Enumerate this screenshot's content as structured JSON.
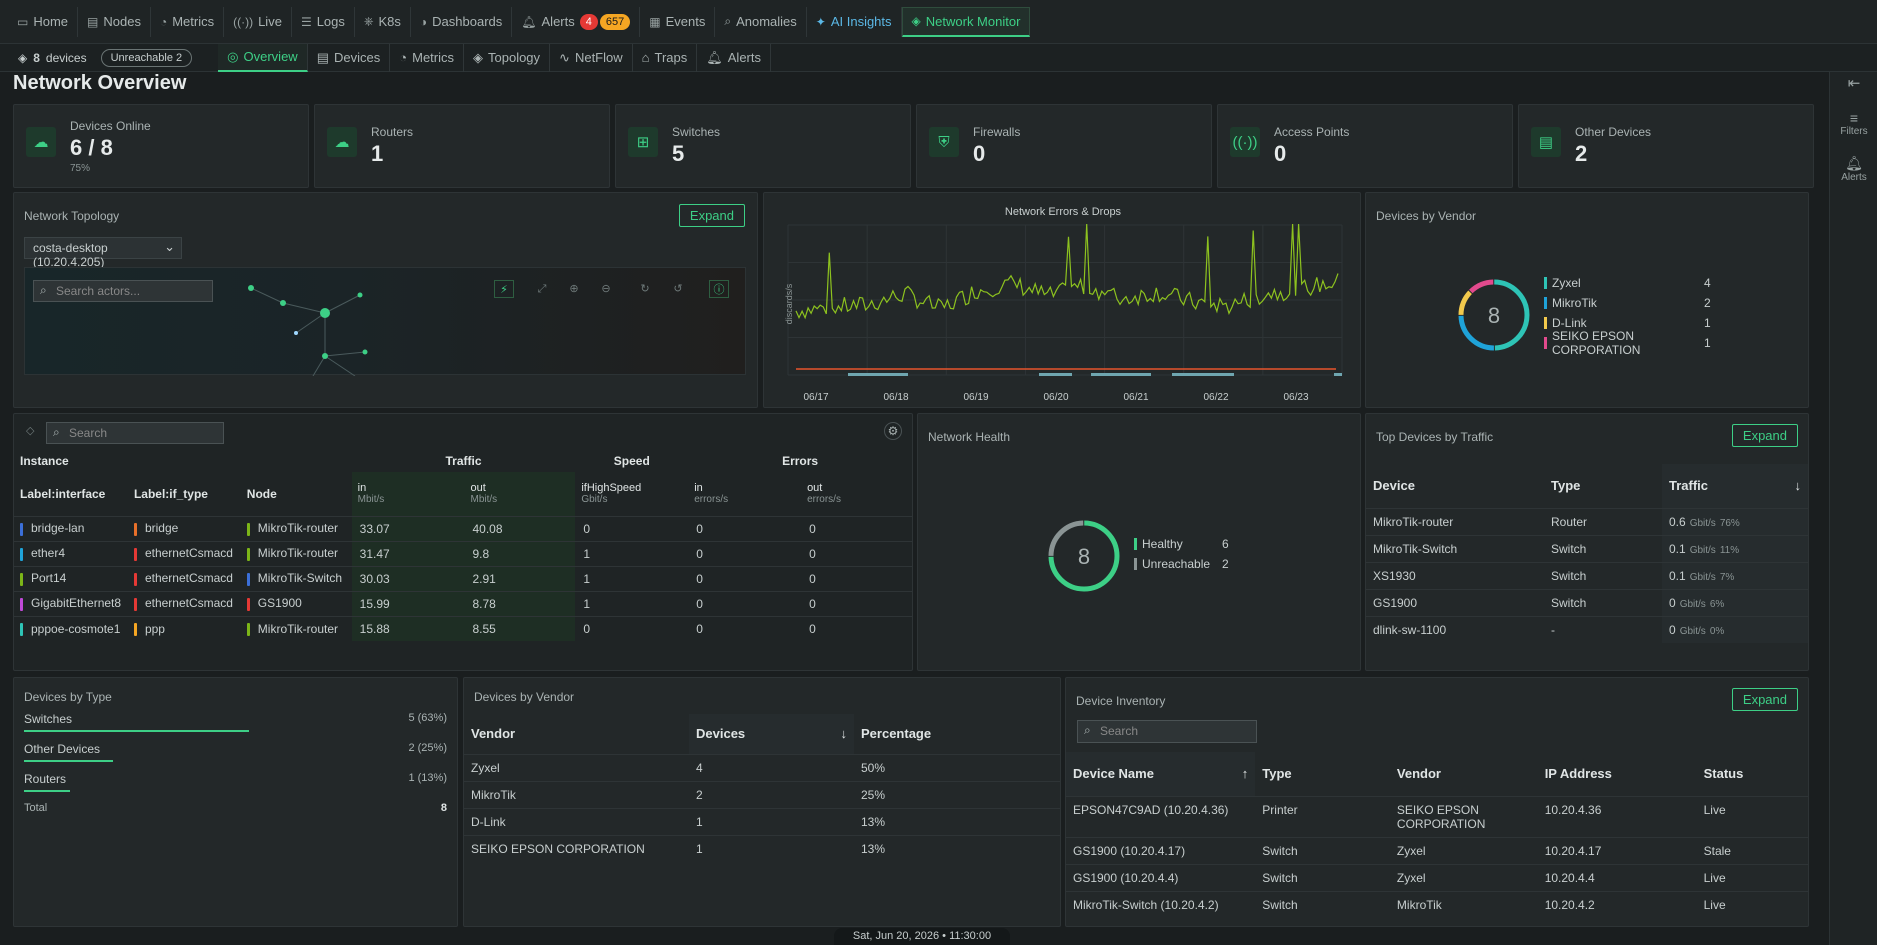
{
  "nav": {
    "tabs": [
      {
        "label": "Home",
        "icon": "monitor-icon"
      },
      {
        "label": "Nodes",
        "icon": "server-icon"
      },
      {
        "label": "Metrics",
        "icon": "metrics-icon"
      },
      {
        "label": "Live",
        "icon": "live-icon"
      },
      {
        "label": "Logs",
        "icon": "logs-icon"
      },
      {
        "label": "K8s",
        "icon": "k8s-icon"
      },
      {
        "label": "Dashboards",
        "icon": "dashboard-icon"
      },
      {
        "label": "Alerts",
        "icon": "bell-icon"
      },
      {
        "label": "Events",
        "icon": "events-icon"
      },
      {
        "label": "Anomalies",
        "icon": "anomaly-icon"
      },
      {
        "label": "AI Insights",
        "icon": "sparkle-icon"
      },
      {
        "label": "Network Monitor",
        "icon": "layers-icon"
      }
    ],
    "alerts_critical": "4",
    "alerts_warning": "657"
  },
  "subnav": {
    "device_count": "8",
    "device_word": "devices",
    "unreachable": "Unreachable 2",
    "tabs": [
      "Overview",
      "Devices",
      "Metrics",
      "Topology",
      "NetFlow",
      "Traps",
      "Alerts"
    ]
  },
  "rail": {
    "filters": "Filters",
    "alerts": "Alerts"
  },
  "page_title": "Network Overview",
  "kpis": [
    {
      "label": "Devices Online",
      "value": "6 / 8",
      "sub": "75%"
    },
    {
      "label": "Routers",
      "value": "1"
    },
    {
      "label": "Switches",
      "value": "5"
    },
    {
      "label": "Firewalls",
      "value": "0"
    },
    {
      "label": "Access Points",
      "value": "0"
    },
    {
      "label": "Other Devices",
      "value": "2"
    }
  ],
  "topology": {
    "title": "Network Topology",
    "expand": "Expand",
    "selected": "costa-desktop (10.20.4.205)",
    "search_placeholder": "Search actors..."
  },
  "errors_chart": {
    "title": "Network Errors & Drops",
    "ylabel": "discards/s"
  },
  "chart_data": {
    "type": "line",
    "title": "Network Errors & Drops",
    "ylabel": "discards/s",
    "x": [
      "06/17",
      "06/18",
      "06/19",
      "06/20",
      "06/21",
      "06/22",
      "06/23"
    ],
    "series": [
      {
        "values": [
          38,
          42,
          45,
          58,
          40,
          62,
          70,
          55,
          68,
          52,
          60,
          48,
          44,
          58,
          64,
          72
        ]
      },
      {
        "values": [
          2,
          2,
          2,
          2,
          2,
          2,
          2,
          2,
          2,
          2,
          2,
          2,
          2,
          2,
          2,
          2
        ]
      }
    ]
  },
  "vendor_donut": {
    "title": "Devices by Vendor",
    "total": "8",
    "items": [
      {
        "name": "Zyxel",
        "count": "4",
        "color": "#2ec4b6",
        "value": 4
      },
      {
        "name": "MikroTik",
        "count": "2",
        "color": "#1fa3d9",
        "value": 2
      },
      {
        "name": "D-Link",
        "count": "1",
        "color": "#f2c94c",
        "value": 1
      },
      {
        "name": "SEIKO EPSON CORPORATION",
        "count": "1",
        "color": "#e24a8d",
        "value": 1
      }
    ]
  },
  "instances": {
    "search_placeholder": "Search",
    "groups": {
      "instance": "Instance",
      "traffic": "Traffic",
      "speed": "Speed",
      "errors": "Errors"
    },
    "cols": {
      "iface": "Label:interface",
      "type": "Label:if_type",
      "node": "Node",
      "in": "in",
      "in_unit": "Mbit/s",
      "out": "out",
      "out_unit": "Mbit/s",
      "speed": "ifHighSpeed",
      "speed_unit": "Gbit/s",
      "ein": "in",
      "ein_unit": "errors/s",
      "eout": "out",
      "eout_unit": "errors/s"
    },
    "rows": [
      {
        "iface": "bridge-lan",
        "ic": "#3b6fd8",
        "type": "bridge",
        "tc": "#e8702a",
        "node": "MikroTik-router",
        "nc": "#7cb518",
        "in": "33.07",
        "out": "40.08",
        "speed": "0",
        "ein": "0",
        "eout": "0"
      },
      {
        "iface": "ether4",
        "ic": "#1fa3d9",
        "type": "ethernetCsmacd",
        "tc": "#e53935",
        "node": "MikroTik-router",
        "nc": "#7cb518",
        "in": "31.47",
        "out": "9.8",
        "speed": "1",
        "ein": "0",
        "eout": "0"
      },
      {
        "iface": "Port14",
        "ic": "#7cb518",
        "type": "ethernetCsmacd",
        "tc": "#e53935",
        "node": "MikroTik-Switch",
        "nc": "#3b6fd8",
        "in": "30.03",
        "out": "2.91",
        "speed": "1",
        "ein": "0",
        "eout": "0"
      },
      {
        "iface": "GigabitEthernet8",
        "ic": "#c04ad8",
        "type": "ethernetCsmacd",
        "tc": "#e53935",
        "node": "GS1900",
        "nc": "#e53935",
        "in": "15.99",
        "out": "8.78",
        "speed": "1",
        "ein": "0",
        "eout": "0"
      },
      {
        "iface": "pppoe-cosmote1",
        "ic": "#2ec4b6",
        "type": "ppp",
        "tc": "#f5a623",
        "node": "MikroTik-router",
        "nc": "#7cb518",
        "in": "15.88",
        "out": "8.55",
        "speed": "0",
        "ein": "0",
        "eout": "0"
      }
    ]
  },
  "health": {
    "title": "Network Health",
    "total": "8",
    "items": [
      {
        "name": "Healthy",
        "count": "6",
        "color": "#3dcf86",
        "value": 6
      },
      {
        "name": "Unreachable",
        "count": "2",
        "color": "#8a9494",
        "value": 2
      }
    ]
  },
  "top_devices": {
    "title": "Top Devices by Traffic",
    "expand": "Expand",
    "cols": [
      "Device",
      "Type",
      "Traffic"
    ],
    "rows": [
      {
        "device": "MikroTik-router",
        "type": "Router",
        "val": "0.6",
        "unit": "Gbit/s",
        "pct": "76%"
      },
      {
        "device": "MikroTik-Switch",
        "type": "Switch",
        "val": "0.1",
        "unit": "Gbit/s",
        "pct": "11%"
      },
      {
        "device": "XS1930",
        "type": "Switch",
        "val": "0.1",
        "unit": "Gbit/s",
        "pct": "7%"
      },
      {
        "device": "GS1900",
        "type": "Switch",
        "val": "0",
        "unit": "Gbit/s",
        "pct": "6%"
      },
      {
        "device": "dlink-sw-1100",
        "type": "-",
        "val": "0",
        "unit": "Gbit/s",
        "pct": "0%"
      }
    ]
  },
  "by_type": {
    "title": "Devices by Type",
    "rows": [
      {
        "label": "Switches",
        "value": "5 (63%)",
        "frac": 0.63
      },
      {
        "label": "Other Devices",
        "value": "2 (25%)",
        "frac": 0.25
      },
      {
        "label": "Routers",
        "value": "1 (13%)",
        "frac": 0.13
      }
    ],
    "total_label": "Total",
    "total": "8"
  },
  "by_vendor": {
    "title": "Devices by Vendor",
    "cols": [
      "Vendor",
      "Devices",
      "Percentage"
    ],
    "rows": [
      [
        "Zyxel",
        "4",
        "50%"
      ],
      [
        "MikroTik",
        "2",
        "25%"
      ],
      [
        "D-Link",
        "1",
        "13%"
      ],
      [
        "SEIKO EPSON CORPORATION",
        "1",
        "13%"
      ]
    ]
  },
  "inventory": {
    "title": "Device Inventory",
    "expand": "Expand",
    "search_placeholder": "Search",
    "cols": [
      "Device Name",
      "Type",
      "Vendor",
      "IP Address",
      "Status"
    ],
    "rows": [
      [
        "EPSON47C9AD (10.20.4.36)",
        "Printer",
        "SEIKO EPSON CORPORATION",
        "10.20.4.36",
        "Live"
      ],
      [
        "GS1900 (10.20.4.17)",
        "Switch",
        "Zyxel",
        "10.20.4.17",
        "Stale"
      ],
      [
        "GS1900 (10.20.4.4)",
        "Switch",
        "Zyxel",
        "10.20.4.4",
        "Live"
      ],
      [
        "MikroTik-Switch (10.20.4.2)",
        "Switch",
        "MikroTik",
        "10.20.4.2",
        "Live"
      ]
    ]
  },
  "status_time": "Sat, Jun 20, 2026 • 11:30:00"
}
